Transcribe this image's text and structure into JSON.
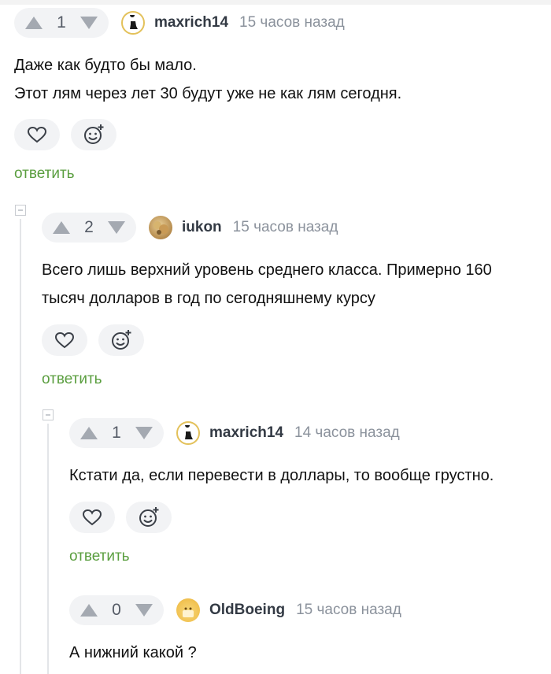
{
  "colors": {
    "reply_green": "#5a9e3f",
    "pill_bg": "#f2f3f5",
    "muted": "#8b929c"
  },
  "labels": {
    "reply": "ответить"
  },
  "comments": [
    {
      "rating": "1",
      "author": "maxrich14",
      "time": "15 часов назад",
      "avatar_icon": "silhouette-avatar",
      "lines": [
        "Даже как будто бы мало.",
        "Этот лям через лет 30 будут уже не как лям сегодня."
      ]
    },
    {
      "rating": "2",
      "author": "iukon",
      "time": "15 часов назад",
      "avatar_icon": "photo-avatar",
      "lines": [
        "Всего лишь верхний уровень среднего класса. Примерно 160",
        "тысяч долларов в год по сегодняшнему курсу"
      ]
    },
    {
      "rating": "1",
      "author": "maxrich14",
      "time": "14 часов назад",
      "avatar_icon": "silhouette-avatar",
      "lines": [
        "Кстати да, если перевести в доллары, то вообще грустно."
      ]
    },
    {
      "rating": "0",
      "author": "OldBoeing",
      "time": "15 часов назад",
      "avatar_icon": "cartoon-avatar",
      "lines": [
        "А нижний какой ?"
      ]
    }
  ]
}
